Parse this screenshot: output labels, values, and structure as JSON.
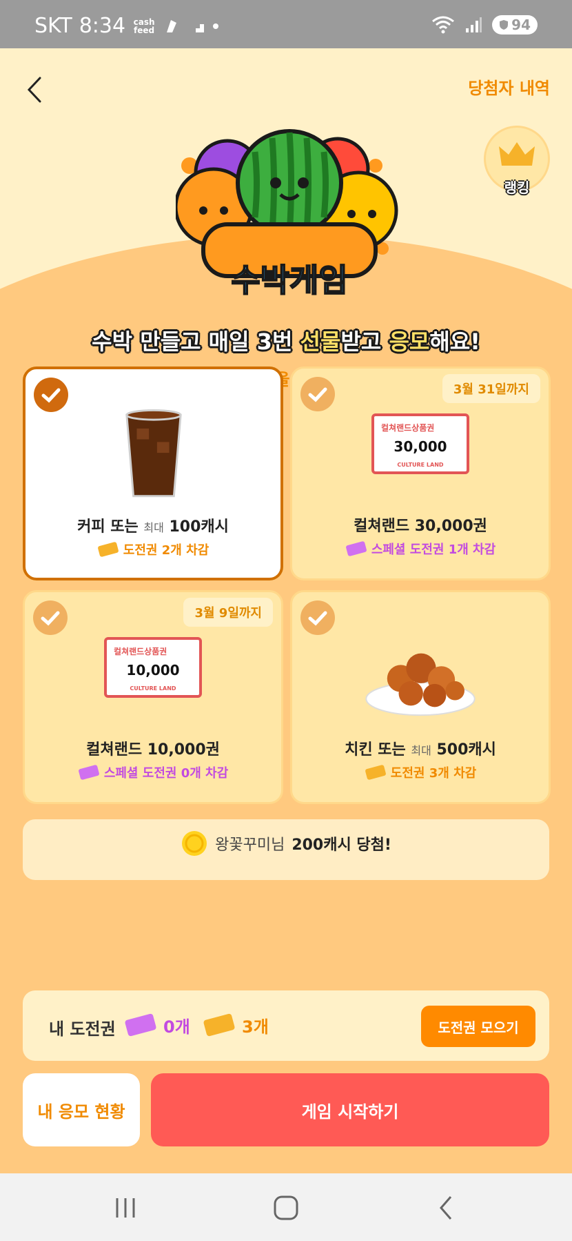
{
  "status_bar": {
    "carrier": "SKT",
    "time": "8:34",
    "cash_feed": "cash feed",
    "battery": "94"
  },
  "header": {
    "winners_link": "당첨자 내역",
    "ranking_label": "랭킹"
  },
  "hero": {
    "logo_text": "수박게임",
    "headline_1": "수박 만들고 매일 3번 ",
    "headline_hl_1": "선물",
    "headline_2": "받고 ",
    "headline_hl_2": "응모",
    "headline_3": "해요!",
    "subhead": "원하는 선물을 눌러주세요!"
  },
  "prizes": [
    {
      "name_1": "커피 또는 ",
      "name_small": "최대",
      "name_2": " 100캐시",
      "cost": "도전권 2개 차감",
      "deadline": "",
      "selected": true
    },
    {
      "name_1": "컬쳐랜드 30,000권",
      "name_small": "",
      "name_2": "",
      "cost": "스페셜 도전권 1개 차감",
      "deadline": "3월 31일까지",
      "voucher_title": "컬쳐랜드상품권",
      "voucher_amount": "30,000",
      "voucher_brand": "CULTURE LAND"
    },
    {
      "name_1": "컬쳐랜드 10,000권",
      "name_small": "",
      "name_2": "",
      "cost": "스페셜 도전권 0개 차감",
      "deadline": "3월 9일까지",
      "voucher_title": "컬쳐랜드상품권",
      "voucher_amount": "10,000",
      "voucher_brand": "CULTURE LAND"
    },
    {
      "name_1": "치킨 또는 ",
      "name_small": "최대",
      "name_2": " 500캐시",
      "cost": "도전권 3개 차감",
      "deadline": ""
    }
  ],
  "ticker": {
    "user": "왕꽃꾸미님",
    "result": "200캐시 당첨!"
  },
  "my_tickets": {
    "label": "내 도전권",
    "special_count": "0개",
    "normal_count": "3개",
    "collect_button": "도전권 모으기"
  },
  "actions": {
    "my_entries": "내 응모 현황",
    "start_game": "게임 시작하기"
  },
  "colors": {
    "accent": "#f08a00",
    "special": "#c24be0",
    "start": "#ff5a55",
    "background": "#ffc97f"
  }
}
